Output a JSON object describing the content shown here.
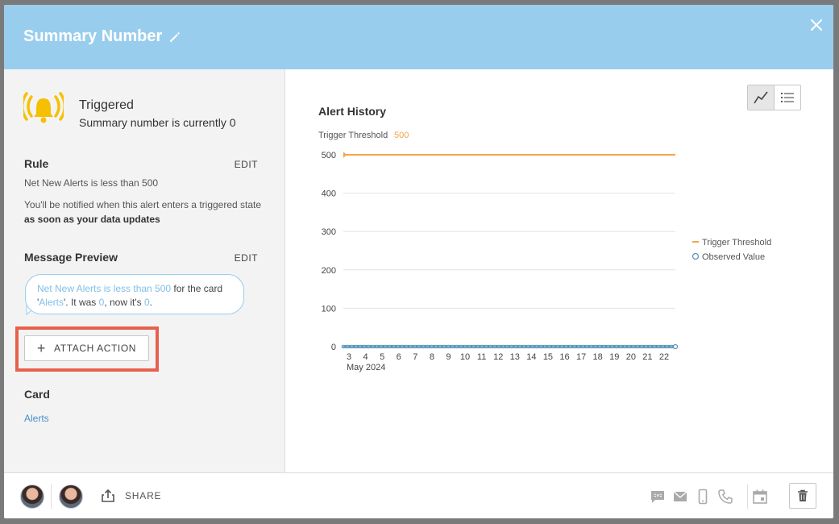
{
  "header": {
    "title": "Summary Number"
  },
  "status": {
    "title": "Triggered",
    "subtitle": "Summary number is currently 0"
  },
  "rule": {
    "heading": "Rule",
    "edit_label": "EDIT",
    "text": "Net New Alerts is less than 500",
    "note_prefix": "You'll be notified when this alert enters a triggered state ",
    "note_bold": "as soon as your data updates"
  },
  "message": {
    "heading": "Message Preview",
    "edit_label": "EDIT",
    "part1": "Net New Alerts is less than 500",
    "part2": " for the card '",
    "part3": "Alerts",
    "part4": "'. It was ",
    "part5": "0",
    "part6": ", now it's ",
    "part7": "0",
    "part8": "."
  },
  "attach": {
    "label": "ATTACH ACTION"
  },
  "card": {
    "heading": "Card",
    "link": "Alerts"
  },
  "chart_panel": {
    "title": "Alert History",
    "threshold_label": "Trigger Threshold",
    "threshold_value": "500"
  },
  "chart_data": {
    "type": "line",
    "x": [
      "3",
      "4",
      "5",
      "6",
      "7",
      "8",
      "9",
      "10",
      "11",
      "12",
      "13",
      "14",
      "15",
      "16",
      "17",
      "18",
      "19",
      "20",
      "21",
      "22"
    ],
    "x_sublabel": "May 2024",
    "yticks": [
      "0",
      "100",
      "200",
      "300",
      "400",
      "500"
    ],
    "ylim": [
      0,
      500
    ],
    "series": [
      {
        "name": "Trigger Threshold",
        "color": "#f5a54a",
        "values": [
          500,
          500,
          500,
          500,
          500,
          500,
          500,
          500,
          500,
          500,
          500,
          500,
          500,
          500,
          500,
          500,
          500,
          500,
          500,
          500
        ]
      },
      {
        "name": "Observed Value",
        "color": "#5b94b8",
        "values": [
          0,
          0,
          0,
          0,
          0,
          0,
          0,
          0,
          0,
          0,
          0,
          0,
          0,
          0,
          0,
          0,
          0,
          0,
          0,
          0
        ]
      }
    ],
    "legend_position": "right"
  },
  "footer": {
    "share_label": "SHARE"
  },
  "colors": {
    "header": "#99cdee",
    "accent": "#f5c000",
    "highlight": "#e8604c",
    "link": "#4a8fc9"
  }
}
